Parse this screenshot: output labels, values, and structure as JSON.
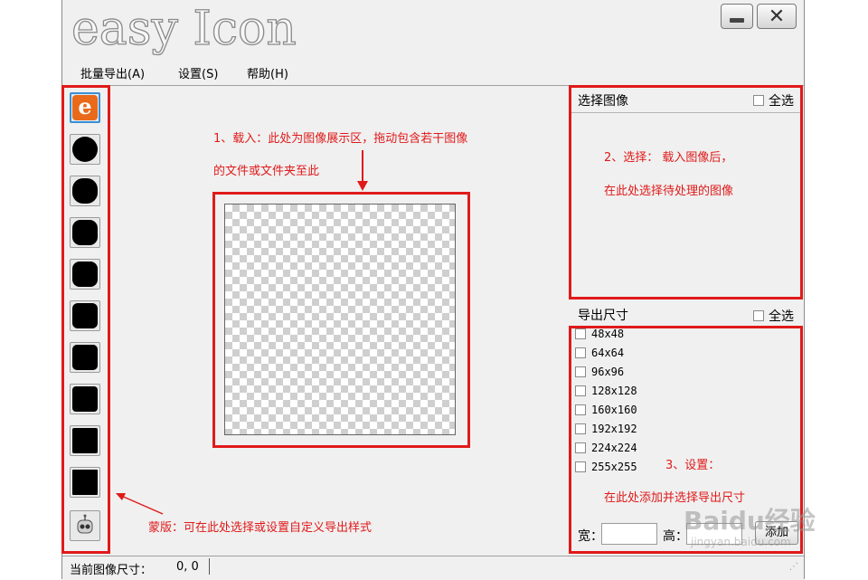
{
  "app": {
    "logo_text": "easy Icon",
    "close_glyph": "✕"
  },
  "menu": [
    "批量导出(A)",
    "设置(S)",
    "帮助(H)"
  ],
  "sidebar": {
    "logo_letter": "e"
  },
  "annotations": {
    "load_line1": "1、载入：此处为图像展示区，拖动包含若干图像",
    "load_line2": "的文件或文件夹至此",
    "select_line1": "2、选择：    载入图像后，",
    "select_line2": "在此处选择待处理的图像",
    "settings_line1": "3、设置：",
    "settings_line2": "在此处添加并选择导出尺寸",
    "mask": "蒙版：可在此处选择或设置自定义导出样式"
  },
  "select_panel": {
    "title": "选择图像",
    "select_all": "全选"
  },
  "size_panel": {
    "title": "导出尺寸",
    "select_all": "全选",
    "sizes": [
      "48x48",
      "64x64",
      "96x96",
      "128x128",
      "160x160",
      "192x192",
      "224x224",
      "255x255"
    ],
    "width_label": "宽：",
    "height_label": "高：",
    "add_button": "添加"
  },
  "status": {
    "label": "当前图像尺寸：",
    "value": "0, 0"
  },
  "watermark": {
    "brand": "Baidu经验",
    "url": "jingyan.baidu.com"
  },
  "colors": {
    "annotation_red": "#e01a1a",
    "window_bg": "#f0f0f0",
    "logo_orange": "#e86a1a"
  }
}
